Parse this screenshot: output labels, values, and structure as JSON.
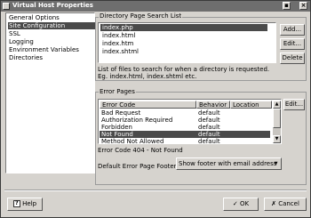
{
  "window": {
    "title": "Virtual Host Properties"
  },
  "nav": {
    "items": [
      {
        "label": "General Options",
        "selected": false
      },
      {
        "label": "Site Configuration",
        "selected": true
      },
      {
        "label": "SSL",
        "selected": false
      },
      {
        "label": "Logging",
        "selected": false
      },
      {
        "label": "Environment Variables",
        "selected": false
      },
      {
        "label": "Directories",
        "selected": false
      }
    ]
  },
  "directory_list": {
    "group_title": "Directory Page Search List",
    "items": [
      "index.php",
      "index.html",
      "index.htm",
      "index.shtml"
    ],
    "selected_index": 0,
    "add_label": "Add...",
    "edit_label": "Edit...",
    "delete_label": "Delete",
    "description_line1": "List of files to search for when a directory is requested.",
    "description_line2": "Eg. index.html, index.shtml etc."
  },
  "error_pages": {
    "group_title": "Error Pages",
    "columns": [
      "Error Code",
      "Behavior",
      "Location"
    ],
    "rows": [
      {
        "code": "Bad Request",
        "behavior": "default",
        "location": ""
      },
      {
        "code": "Authorization Required",
        "behavior": "default",
        "location": ""
      },
      {
        "code": "Forbidden",
        "behavior": "default",
        "location": ""
      },
      {
        "code": "Not Found",
        "behavior": "default",
        "location": ""
      },
      {
        "code": "Method Not Allowed",
        "behavior": "default",
        "location": ""
      }
    ],
    "selected_index": 3,
    "edit_label": "Edit...",
    "status_text": "Error Code 404 - Not Found",
    "footer_label": "Default Error Page Footer:",
    "footer_value": "Show footer with email address"
  },
  "buttons": {
    "help": "Help",
    "ok": "OK",
    "cancel": "Cancel"
  },
  "colors": {
    "selection": "#4a4a4a",
    "window_bg": "#d6d3ce",
    "titlebar": "#6e6e6e"
  }
}
